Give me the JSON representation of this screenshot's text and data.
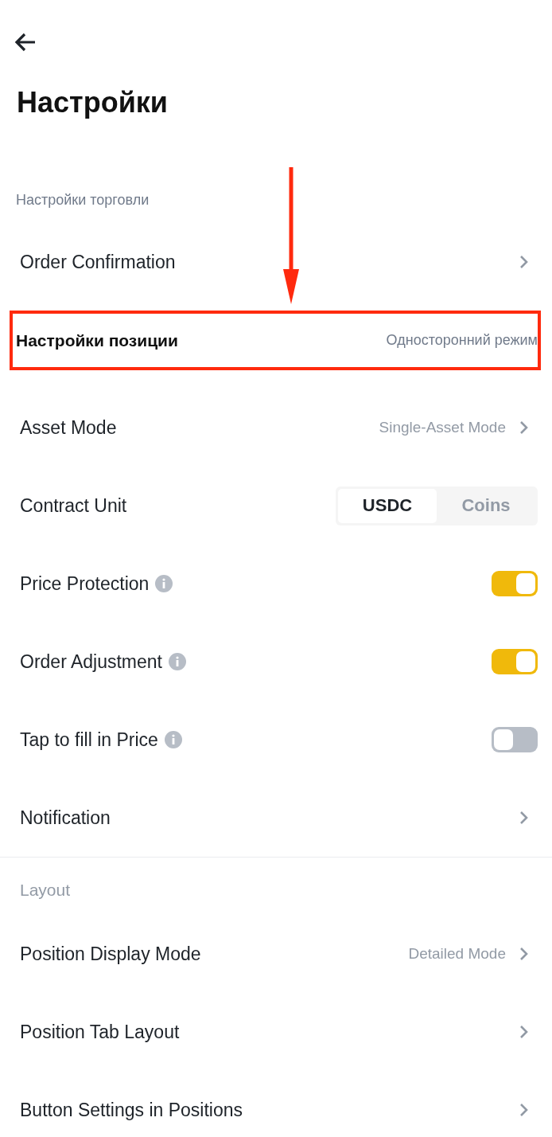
{
  "title": "Настройки",
  "sections": [
    {
      "label": "Настройки торговли",
      "rows": [
        {
          "kind": "link",
          "label": "Order Confirmation"
        },
        {
          "kind": "annotated",
          "label": "Настройки позиции",
          "value": "Односторонний режим"
        },
        {
          "kind": "link",
          "label": "Asset Mode",
          "value": "Single-Asset Mode"
        },
        {
          "kind": "segmented",
          "label": "Contract Unit",
          "options": [
            {
              "label": "USDC",
              "selected": true
            },
            {
              "label": "Coins",
              "selected": false
            }
          ]
        },
        {
          "kind": "toggle",
          "label": "Price Protection",
          "info": true,
          "on": true
        },
        {
          "kind": "toggle",
          "label": "Order Adjustment",
          "info": true,
          "on": true
        },
        {
          "kind": "toggle",
          "label": "Tap to fill in Price",
          "info": true,
          "on": false
        },
        {
          "kind": "link",
          "label": "Notification"
        }
      ]
    },
    {
      "label": "Layout",
      "rows": [
        {
          "kind": "link",
          "label": "Position Display Mode",
          "value": "Detailed Mode"
        },
        {
          "kind": "link",
          "label": "Position Tab Layout"
        },
        {
          "kind": "link",
          "label": "Button Settings in Positions"
        }
      ]
    }
  ]
}
